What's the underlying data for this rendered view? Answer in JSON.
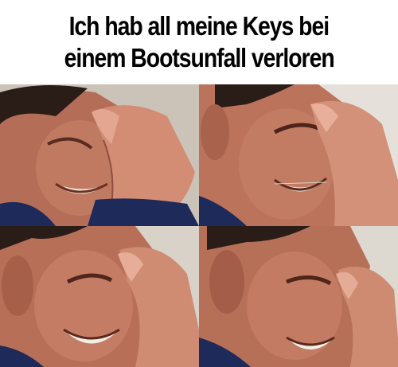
{
  "meme": {
    "caption_line_1": "Ich hab all meine Keys bei",
    "caption_line_2": "einem Bootsunfall verloren",
    "text_color": "#000000",
    "background_color": "#ffffff"
  },
  "panels": [
    {
      "name": "panel-crying-1"
    },
    {
      "name": "panel-crying-2"
    },
    {
      "name": "panel-crying-3"
    },
    {
      "name": "panel-crying-4"
    }
  ],
  "colors": {
    "skin": "#c9826a",
    "skin_shadow": "#8f4f3e",
    "hair": "#2a1c17",
    "shirt": "#1d2a5a",
    "background": "#d9d4cc",
    "teeth": "#f2efe6"
  }
}
